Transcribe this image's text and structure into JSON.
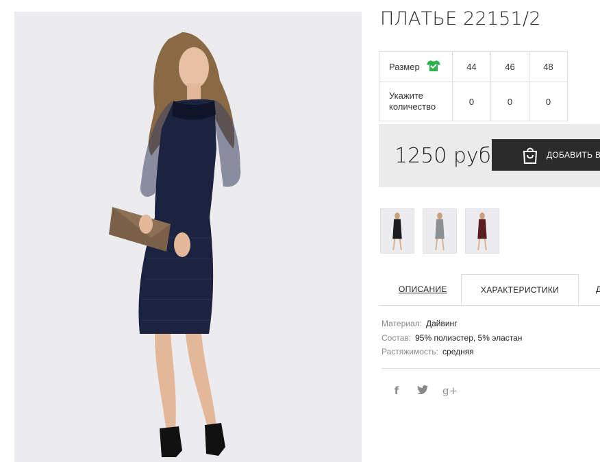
{
  "product": {
    "title": "ПЛАТЬЕ 22151/2",
    "price": "1250 руб",
    "add_to_cart_label": "ДОБАВИТЬ В"
  },
  "size_table": {
    "size_label": "Размер",
    "quantity_label_line1": "Укажите",
    "quantity_label_line2": "количество",
    "sizes": [
      "44",
      "46",
      "48"
    ],
    "quantities": [
      "0",
      "0",
      "0"
    ],
    "size_icon": "tshirt-check-icon",
    "size_icon_color": "#2bb24c"
  },
  "thumbnails": [
    {
      "name": "black-dress-thumb",
      "color": "#1b1b1f"
    },
    {
      "name": "grey-dress-thumb",
      "color": "#8e8f93"
    },
    {
      "name": "burgundy-dress-thumb",
      "color": "#5a1d22"
    }
  ],
  "tabs": {
    "description": "ОПИСАНИЕ",
    "characteristics": "ХАРАКТЕРИСТИКИ",
    "more": "Д"
  },
  "specs": [
    {
      "key": "Материал:",
      "value": "Дайвинг"
    },
    {
      "key": "Состав:",
      "value": "95% полиэстер, 5% эластан"
    },
    {
      "key": "Растяжимость:",
      "value": "средняя"
    }
  ],
  "social": {
    "facebook": "f",
    "twitter": "t",
    "google": "g+"
  },
  "colors": {
    "price_box_bg": "#ebebeb",
    "button_bg": "#2b2b2b",
    "dress": "#1c2340"
  }
}
